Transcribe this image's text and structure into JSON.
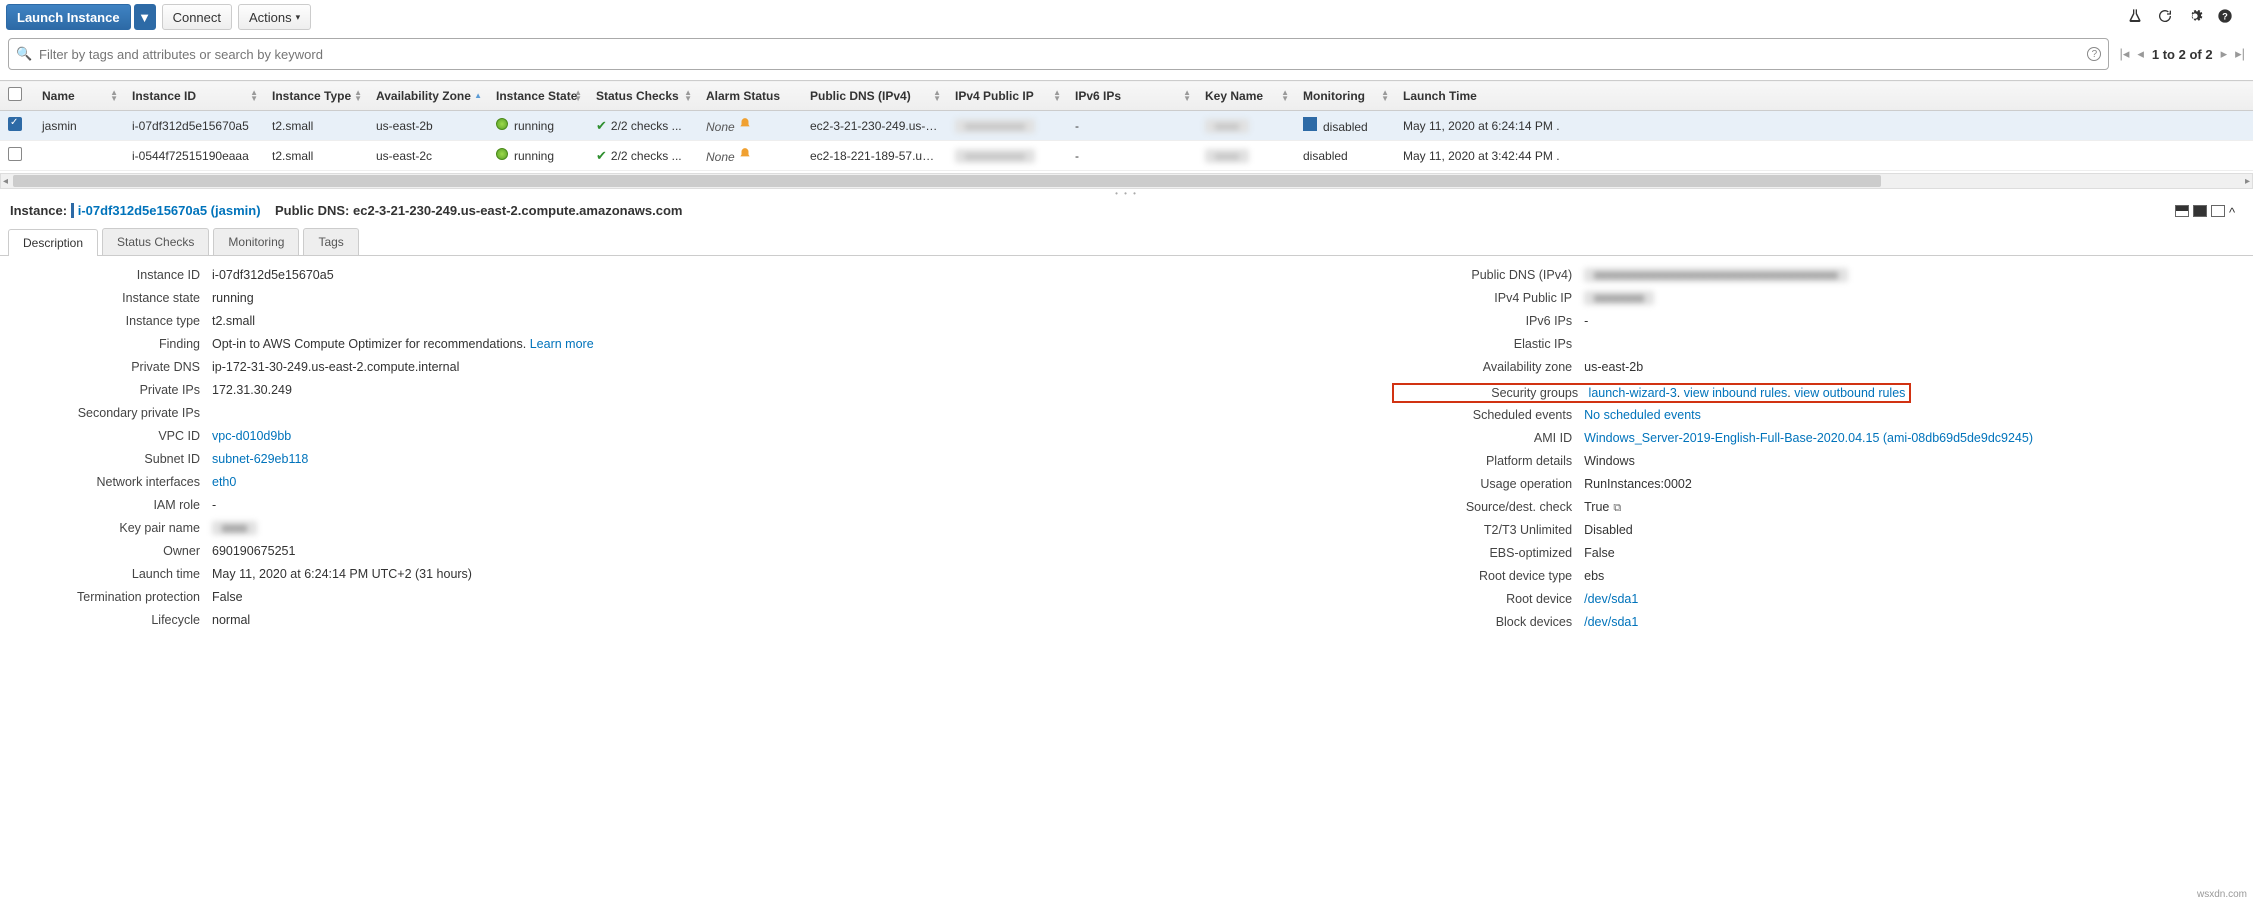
{
  "toolbar": {
    "launch": "Launch Instance",
    "connect": "Connect",
    "actions": "Actions"
  },
  "search": {
    "placeholder": "Filter by tags and attributes or search by keyword"
  },
  "pager": {
    "text": "1 to 2 of 2"
  },
  "columns": {
    "name": "Name",
    "iid": "Instance ID",
    "itype": "Instance Type",
    "az": "Availability Zone",
    "state": "Instance State",
    "checks": "Status Checks",
    "alarm": "Alarm Status",
    "dns": "Public DNS (IPv4)",
    "ip4": "IPv4 Public IP",
    "ip6": "IPv6 IPs",
    "key": "Key Name",
    "mon": "Monitoring",
    "launch": "Launch Time"
  },
  "rows": [
    {
      "selected": true,
      "name": "jasmin",
      "iid": "i-07df312d5e15670a5",
      "itype": "t2.small",
      "az": "us-east-2b",
      "state": "running",
      "checks": "2/2 checks ...",
      "alarm": "None",
      "dns": "ec2-3-21-230-249.us-e...",
      "ip4": "",
      "ip6": "-",
      "key": "",
      "mon_blue": true,
      "mon": "disabled",
      "launch": "May 11, 2020 at 6:24:14 PM ."
    },
    {
      "selected": false,
      "name": "",
      "iid": "i-0544f72515190eaaa",
      "itype": "t2.small",
      "az": "us-east-2c",
      "state": "running",
      "checks": "2/2 checks ...",
      "alarm": "None",
      "dns": "ec2-18-221-189-57.us-...",
      "ip4": "",
      "ip6": "-",
      "key": "",
      "mon_blue": false,
      "mon": "disabled",
      "launch": "May 11, 2020 at 3:42:44 PM ."
    }
  ],
  "details": {
    "header_label": "Instance:",
    "header_id": "i-07df312d5e15670a5 (jasmin)",
    "dns_label": "Public DNS:",
    "dns_val": "ec2-3-21-230-249.us-east-2.compute.amazonaws.com"
  },
  "tabs": {
    "desc": "Description",
    "status": "Status Checks",
    "mon": "Monitoring",
    "tags": "Tags"
  },
  "left": {
    "iid_l": "Instance ID",
    "iid_v": "i-07df312d5e15670a5",
    "state_l": "Instance state",
    "state_v": "running",
    "itype_l": "Instance type",
    "itype_v": "t2.small",
    "find_l": "Finding",
    "find_v": "Opt-in to AWS Compute Optimizer for recommendations.",
    "find_link": "Learn more",
    "pdns_l": "Private DNS",
    "pdns_v": "ip-172-31-30-249.us-east-2.compute.internal",
    "pip_l": "Private IPs",
    "pip_v": "172.31.30.249",
    "spip_l": "Secondary private IPs",
    "spip_v": "",
    "vpc_l": "VPC ID",
    "vpc_v": "vpc-d010d9bb",
    "sub_l": "Subnet ID",
    "sub_v": "subnet-629eb118",
    "ni_l": "Network interfaces",
    "ni_v": "eth0",
    "iam_l": "IAM role",
    "iam_v": "-",
    "kp_l": "Key pair name",
    "kp_v": "",
    "own_l": "Owner",
    "own_v": "690190675251",
    "lt_l": "Launch time",
    "lt_v": "May 11, 2020 at 6:24:14 PM UTC+2 (31 hours)",
    "tp_l": "Termination protection",
    "tp_v": "False",
    "lc_l": "Lifecycle",
    "lc_v": "normal"
  },
  "right": {
    "pdns_l": "Public DNS (IPv4)",
    "pdns_v": "",
    "pip4_l": "IPv4 Public IP",
    "pip4_v": "",
    "ip6_l": "IPv6 IPs",
    "ip6_v": "-",
    "eip_l": "Elastic IPs",
    "eip_v": "",
    "az_l": "Availability zone",
    "az_v": "us-east-2b",
    "sg_l": "Security groups",
    "sg_v1": "launch-wizard-3",
    "sg_v2": "view inbound rules",
    "sg_v3": "view outbound rules",
    "se_l": "Scheduled events",
    "se_v": "No scheduled events",
    "ami_l": "AMI ID",
    "ami_v": "Windows_Server-2019-English-Full-Base-2020.04.15 (ami-08db69d5de9dc9245)",
    "pd_l": "Platform details",
    "pd_v": "Windows",
    "uo_l": "Usage operation",
    "uo_v": "RunInstances:0002",
    "sdc_l": "Source/dest. check",
    "sdc_v": "True",
    "t23_l": "T2/T3 Unlimited",
    "t23_v": "Disabled",
    "ebs_l": "EBS-optimized",
    "ebs_v": "False",
    "rdt_l": "Root device type",
    "rdt_v": "ebs",
    "rd_l": "Root device",
    "rd_v": "/dev/sda1",
    "bd_l": "Block devices",
    "bd_v": "/dev/sda1"
  },
  "watermark": "wsxdn.com"
}
